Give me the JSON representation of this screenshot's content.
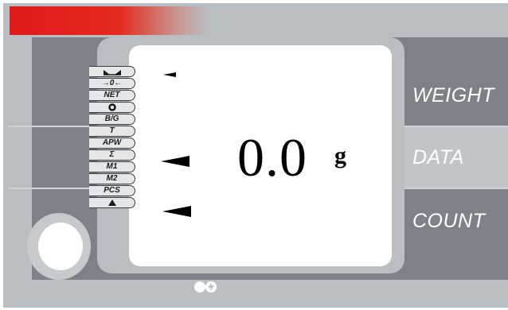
{
  "display": {
    "reading": "0.0",
    "unit": "g"
  },
  "indicators": [
    {
      "label": "",
      "icon": "stability-icon"
    },
    {
      "label": "→0←",
      "icon": "zero-icon"
    },
    {
      "label": "NET"
    },
    {
      "label": "",
      "icon": "ring-icon"
    },
    {
      "label": "B/G"
    },
    {
      "label": "T"
    },
    {
      "label": "APW"
    },
    {
      "label": "Σ"
    },
    {
      "label": "M1"
    },
    {
      "label": "M2"
    },
    {
      "label": "PCS"
    },
    {
      "label": "",
      "icon": "up-triangle-icon"
    }
  ],
  "side_labels": {
    "weight": "WEIGHT",
    "data": "DATA",
    "count": "COUNT"
  },
  "colors": {
    "accent_red": "#e01a1a",
    "panel_gray": "#b9bec3",
    "band_gray": "#7e8288"
  }
}
